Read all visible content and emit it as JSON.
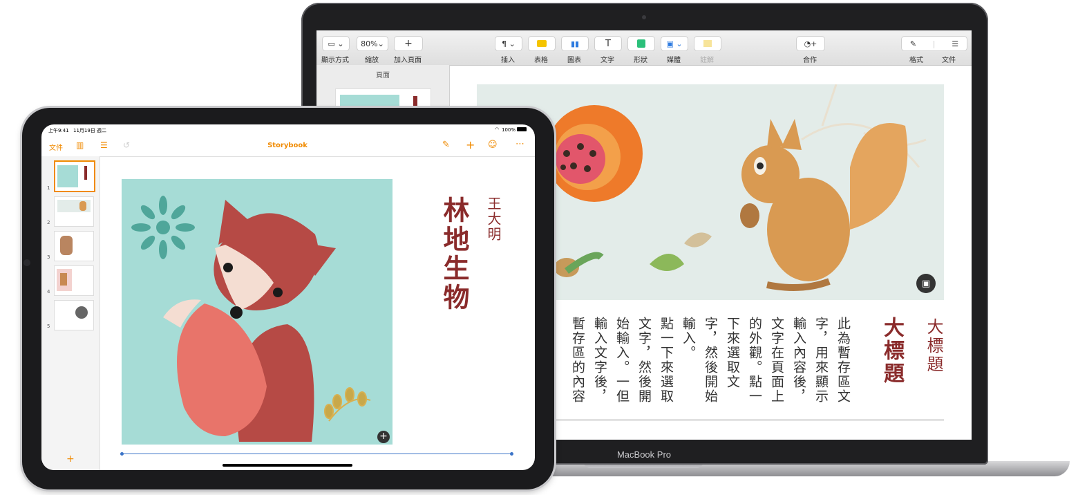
{
  "mac": {
    "brand": "MacBook Pro",
    "toolbar": {
      "view_label": "顯示方式",
      "zoom_value": "80%",
      "zoom_label": "縮放",
      "add_page_label": "加入頁面",
      "insert_label": "插入",
      "table_label": "表格",
      "chart_label": "圖表",
      "text_label": "文字",
      "shape_label": "形狀",
      "media_label": "媒體",
      "comment_label": "註解",
      "collaborate_label": "合作",
      "format_label": "格式",
      "document_label": "文件"
    },
    "sidebar": {
      "title": "頁面"
    },
    "page": {
      "heading_large": "大標題",
      "heading_small": "大標題",
      "body_columns": [
        "此為暫存區文",
        "字，用來顯示",
        "輸入內容後，",
        "文字在頁面上",
        "的外觀。點一",
        "下來選取文",
        "字，然後開始",
        "輸入。",
        "點一下來選取",
        "文字，然後開",
        "始輸入。一但",
        "輸入文字後，",
        "暫存區的內容"
      ]
    }
  },
  "ipad": {
    "status": {
      "time": "上午9:41",
      "date": "11月19日 週二",
      "battery": "100%"
    },
    "nav": {
      "documents_label": "文件",
      "title": "Storybook"
    },
    "page_numbers": [
      "1",
      "2",
      "3",
      "4",
      "5"
    ],
    "add_page_symbol": "+",
    "page": {
      "title": "林地生物",
      "author": "王大明"
    }
  },
  "colors": {
    "accent": "#f08a00",
    "title_red": "#8a2b2b",
    "fox_bg": "#a6dcd6",
    "squirrel_bg": "#e3ece9"
  }
}
